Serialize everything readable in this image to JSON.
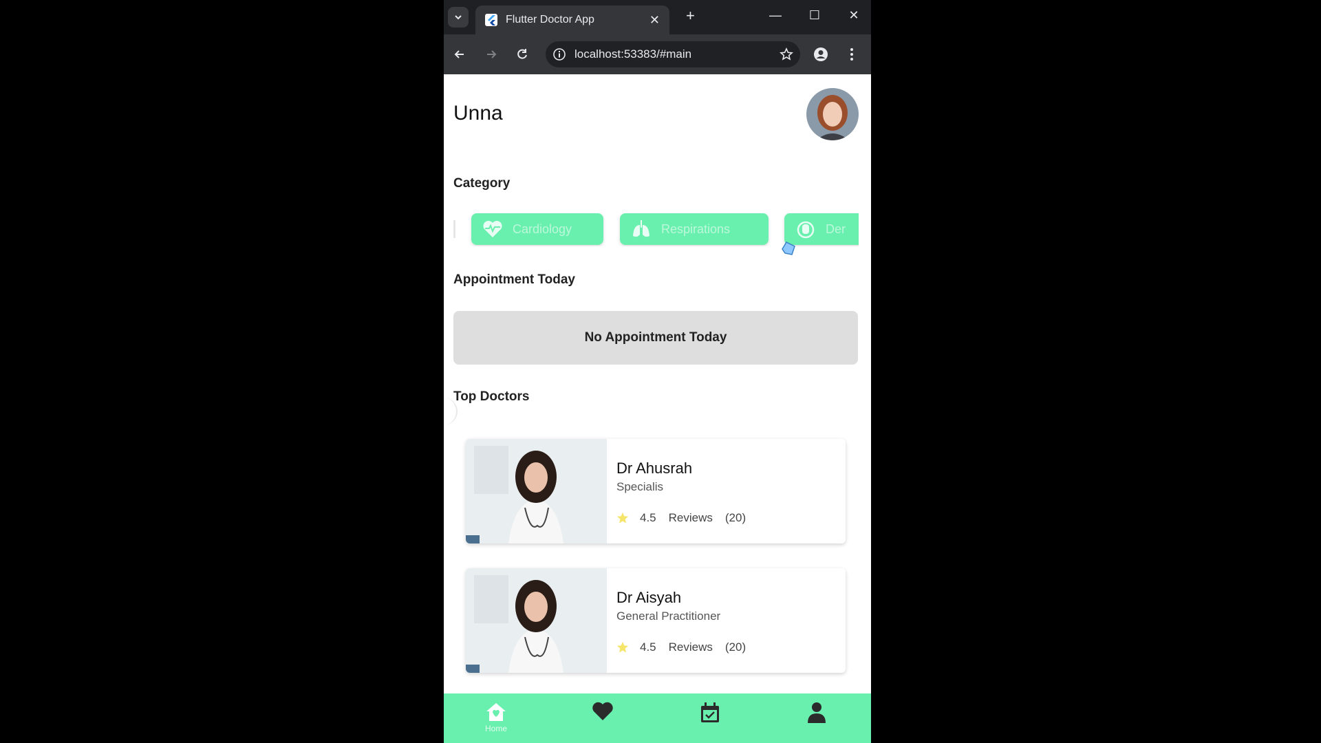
{
  "browser": {
    "tab_title": "Flutter Doctor App",
    "url": "localhost:53383/#main"
  },
  "app": {
    "username": "Unna",
    "sections": {
      "category": "Category",
      "appointment": "Appointment Today",
      "top_doctors": "Top Doctors"
    },
    "categories": [
      {
        "label": "Cardiology",
        "icon": "heart-monitor-icon"
      },
      {
        "label": "Respirations",
        "icon": "lungs-icon"
      },
      {
        "label": "Der",
        "icon": "hand-icon"
      }
    ],
    "appointment_empty": "No Appointment Today",
    "doctors": [
      {
        "name": "Dr Ahusrah",
        "specialty": "Specialis",
        "rating": "4.5",
        "reviews_label": "Reviews",
        "reviews_count": "(20)"
      },
      {
        "name": "Dr Aisyah",
        "specialty": "General Practitioner",
        "rating": "4.5",
        "reviews_label": "Reviews",
        "reviews_count": "(20)"
      }
    ],
    "bottom_nav": [
      {
        "label": "Home",
        "icon": "home-icon",
        "active": true
      },
      {
        "label": "",
        "icon": "heart-icon"
      },
      {
        "label": "",
        "icon": "calendar-check-icon"
      },
      {
        "label": "",
        "icon": "person-icon"
      }
    ],
    "colors": {
      "accent": "#69f0ae",
      "star": "#f5e66b"
    }
  }
}
